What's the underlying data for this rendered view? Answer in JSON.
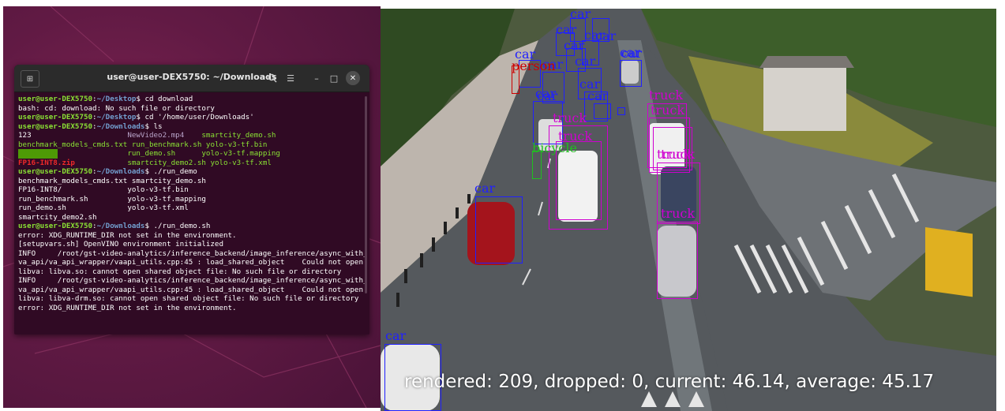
{
  "colors": {
    "terminal_bg": "#300a24",
    "prompt_user": "#8ae234",
    "prompt_path": "#729fcf",
    "label_car": "#2020ff",
    "label_truck": "#d000d0",
    "label_person": "#cc0000",
    "label_bicycle": "#20c020"
  },
  "terminal": {
    "title": "user@user-DEX5750: ~/Downloads",
    "icons": [
      "new-tab-icon",
      "search-icon",
      "hamburger-menu-icon",
      "minimize-icon",
      "maximize-icon",
      "close-icon"
    ],
    "lines": [
      {
        "user": "user@user-DEX5750",
        "path": "~/Desktop",
        "cmd": "$ cd download"
      },
      {
        "text": "bash: cd: download: No such file or directory"
      },
      {
        "user": "user@user-DEX5750",
        "path": "~/Desktop",
        "cmd": "$ cd '/home/user/Downloads'"
      },
      {
        "user": "user@user-DEX5750",
        "path": "~/Downloads",
        "cmd": "$ ls"
      },
      {
        "cols": [
          {
            "t": "123",
            "c": ""
          },
          {
            "t": "NewVideo2.mp4",
            "c": "c-mp4"
          },
          {
            "t": "smartcity_demo.sh",
            "c": "c-sh"
          }
        ]
      },
      {
        "cols": [
          {
            "t": "benchmark_models_cmds.txt",
            "c": "c-sh"
          },
          {
            "t": "run_benchmark.sh",
            "c": "c-sh"
          },
          {
            "t": "yolo-v3-tf.bin",
            "c": "c-sh"
          }
        ]
      },
      {
        "cols": [
          {
            "t": "FP16-INT8",
            "c": "c-dir-bg"
          },
          {
            "t": "run_demo.sh",
            "c": "c-sh"
          },
          {
            "t": "yolo-v3-tf.mapping",
            "c": "c-sh"
          }
        ]
      },
      {
        "cols": [
          {
            "t": "FP16-INT8.zip",
            "c": "c-zip"
          },
          {
            "t": "smartcity_demo2.sh",
            "c": "c-sh"
          },
          {
            "t": "yolo-v3-tf.xml",
            "c": "c-sh"
          }
        ]
      },
      {
        "user": "user@user-DEX5750",
        "path": "~/Downloads",
        "cmd": "$ ./run_demo"
      },
      {
        "cols": [
          {
            "t": "benchmark_models_cmds.txt",
            "c": ""
          },
          {
            "t": "smartcity_demo.sh",
            "c": ""
          }
        ]
      },
      {
        "cols": [
          {
            "t": "FP16-INT8/",
            "c": ""
          },
          {
            "t": "yolo-v3-tf.bin",
            "c": ""
          }
        ]
      },
      {
        "cols": [
          {
            "t": "run_benchmark.sh",
            "c": ""
          },
          {
            "t": "yolo-v3-tf.mapping",
            "c": ""
          }
        ]
      },
      {
        "cols": [
          {
            "t": "run_demo.sh",
            "c": ""
          },
          {
            "t": "yolo-v3-tf.xml",
            "c": ""
          }
        ]
      },
      {
        "text": "smartcity_demo2.sh"
      },
      {
        "user": "user@user-DEX5750",
        "path": "~/Downloads",
        "cmd": "$ ./run_demo.sh"
      },
      {
        "text": "error: XDG_RUNTIME_DIR not set in the environment."
      },
      {
        "text": "[setupvars.sh] OpenVINO environment initialized"
      },
      {
        "text": "INFO     /root/gst-video-analytics/inference_backend/image_inference/async_with_"
      },
      {
        "text": "va_api/va_api_wrapper/vaapi_utils.cpp:45 : load_shared_object    Could not open"
      },
      {
        "text": "libva: libva.so: cannot open shared object file: No such file or directory"
      },
      {
        "text": "INFO     /root/gst-video-analytics/inference_backend/image_inference/async_with_"
      },
      {
        "text": "va_api/va_api_wrapper/vaapi_utils.cpp:45 : load_shared_object    Could not open"
      },
      {
        "text": "libva: libva-drm.so: cannot open shared object file: No such file or directory"
      },
      {
        "text": "error: XDG_RUNTIME_DIR not set in the environment."
      }
    ]
  },
  "video": {
    "stats": "rendered: 209, dropped: 0, current: 46.14, average: 45.17",
    "detections": [
      {
        "label": "car",
        "cls": "car"
      },
      {
        "label": "car",
        "cls": "car"
      },
      {
        "label": "car",
        "cls": "car"
      },
      {
        "label": "car",
        "cls": "car"
      },
      {
        "label": "car",
        "cls": "car"
      },
      {
        "label": "car",
        "cls": "car"
      },
      {
        "label": "car",
        "cls": "car"
      },
      {
        "label": "car",
        "cls": "car"
      },
      {
        "label": "car",
        "cls": "car"
      },
      {
        "label": "car",
        "cls": "car"
      },
      {
        "label": "car",
        "cls": "car"
      },
      {
        "label": "car",
        "cls": "car"
      },
      {
        "label": "person",
        "cls": "person"
      },
      {
        "label": "car",
        "cls": "car"
      },
      {
        "label": "car",
        "cls": "car"
      },
      {
        "label": "truck",
        "cls": "truck"
      },
      {
        "label": "truck",
        "cls": "truck"
      },
      {
        "label": "truck",
        "cls": "truck"
      },
      {
        "label": "truck",
        "cls": "truck"
      },
      {
        "label": "truck",
        "cls": "truck"
      },
      {
        "label": "bicycle",
        "cls": "bicycle"
      },
      {
        "label": "truck",
        "cls": "truck"
      },
      {
        "label": "truck",
        "cls": "truck"
      },
      {
        "label": "car",
        "cls": "car"
      },
      {
        "label": "car",
        "cls": "car"
      }
    ]
  }
}
